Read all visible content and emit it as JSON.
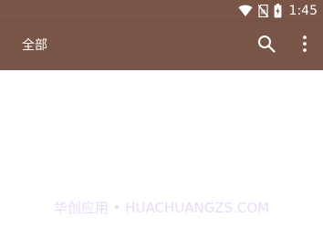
{
  "status_bar": {
    "time": "1:45",
    "icons": [
      "wifi-icon",
      "no-sim-icon",
      "battery-charging-icon"
    ],
    "color": "#795548"
  },
  "app_bar": {
    "title": "全部",
    "actions": [
      "search-icon",
      "more-vert-icon"
    ],
    "color": "#795548"
  },
  "watermark": {
    "text": "华创应用 • HUACHUANGZS.COM"
  }
}
